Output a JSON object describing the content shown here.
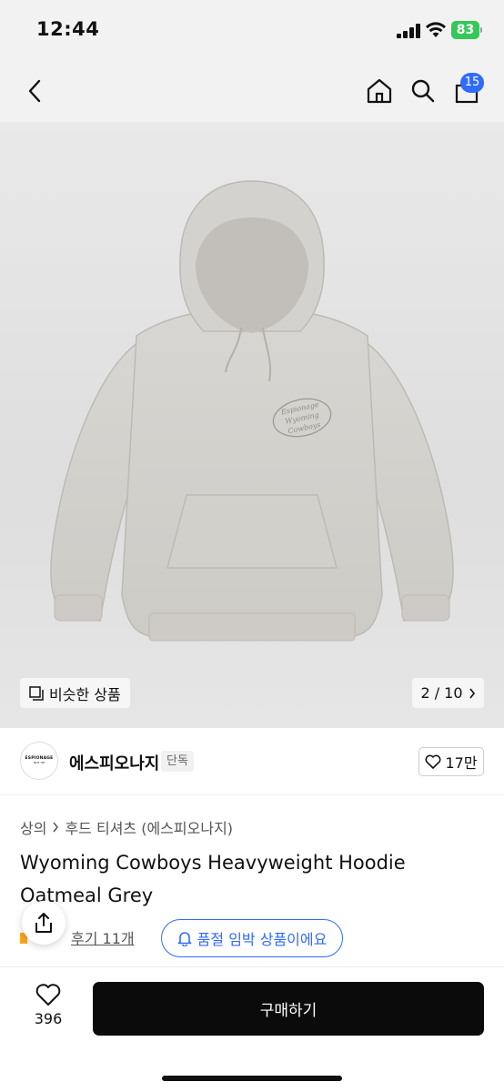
{
  "status_bar": {
    "time": "12:44",
    "battery": "83"
  },
  "nav": {
    "back_icon": "chevron-left-icon",
    "home_icon": "home-icon",
    "search_icon": "search-icon",
    "cart_icon": "bag-icon",
    "cart_count": "15"
  },
  "product_image": {
    "similar_label": "비슷한 상품",
    "pager": "2 / 10",
    "print_line1": "Espionage",
    "print_line2": "Wyoming",
    "print_line3": "Cowboys"
  },
  "brand": {
    "name": "에스피오나지",
    "tag": "단독",
    "logo_text": "ESPIONAGE",
    "logo_sub": "NOT '98",
    "likes": "17만"
  },
  "breadcrumb": [
    "상의",
    "후드 티셔츠 (에스피오나지)"
  ],
  "product": {
    "title": "Wyoming Cowboys Heavyweight Hoodie Oatmeal Grey",
    "reviews_label": "후기 11개",
    "soldout_label": "품절 임박 상품이에요"
  },
  "bottom_bar": {
    "wish_count": "396",
    "buy_label": "구매하기"
  },
  "colors": {
    "accent": "#2f6bff",
    "buy": "#0b0b0b",
    "battery": "#34c759"
  }
}
